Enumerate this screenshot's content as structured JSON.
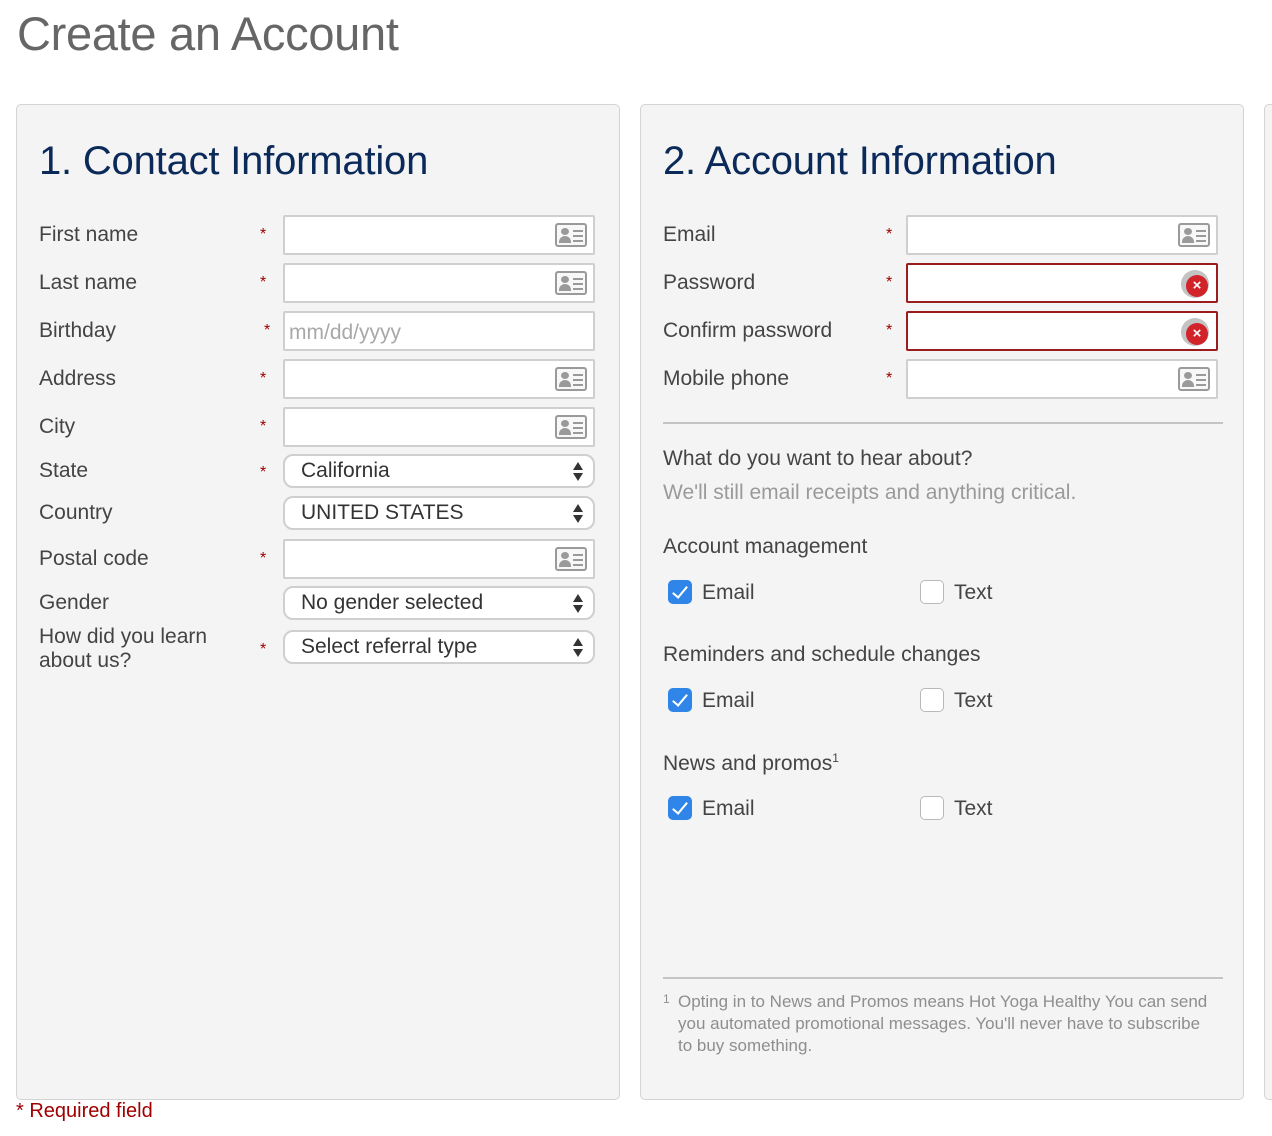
{
  "page": {
    "title": "Create an Account"
  },
  "contact": {
    "heading": "1. Contact Information",
    "required_mark": "*",
    "fields": {
      "first_name": {
        "label": "First name"
      },
      "last_name": {
        "label": "Last name"
      },
      "birthday": {
        "label": "Birthday",
        "placeholder": "mm/dd/yyyy"
      },
      "address": {
        "label": "Address"
      },
      "city": {
        "label": "City"
      },
      "state": {
        "label": "State",
        "value": "California"
      },
      "country": {
        "label": "Country",
        "value": "UNITED STATES"
      },
      "postal_code": {
        "label": "Postal code"
      },
      "gender": {
        "label": "Gender",
        "value": "No gender selected"
      },
      "referral": {
        "label_line1": "How did you learn",
        "label_line2": "about us?",
        "value": "Select referral type"
      }
    }
  },
  "account": {
    "heading": "2. Account Information",
    "fields": {
      "email": {
        "label": "Email"
      },
      "password": {
        "label": "Password",
        "state": "error"
      },
      "confirm_password": {
        "label": "Confirm password",
        "state": "error"
      },
      "mobile_phone": {
        "label": "Mobile phone"
      }
    },
    "preferences": {
      "question": "What do you want to hear about?",
      "subtext": "We'll still email receipts and anything critical.",
      "groups": [
        {
          "title": "Account management",
          "email_label": "Email",
          "email_checked": true,
          "text_label": "Text",
          "text_checked": false
        },
        {
          "title": "Reminders and schedule changes",
          "email_label": "Email",
          "email_checked": true,
          "text_label": "Text",
          "text_checked": false
        },
        {
          "title": "News and promos",
          "title_sup": "1",
          "email_label": "Email",
          "email_checked": true,
          "text_label": "Text",
          "text_checked": false
        }
      ]
    },
    "footnote": {
      "number": "1",
      "text": "Opting in to News and Promos means Hot Yoga Healthy You can send you automated promotional messages. You'll never have to subscribe to buy something."
    }
  },
  "required_note": "* Required field",
  "icons": {
    "contact_card": "contact-card-icon",
    "error": "error-x-icon",
    "select_arrows": "select-arrows-icon",
    "checkmark": "checkmark-icon"
  },
  "colors": {
    "heading": "#0b2a5a",
    "required": "#a00000",
    "error_border": "#9b1c1c",
    "checkbox": "#2f85e8"
  }
}
